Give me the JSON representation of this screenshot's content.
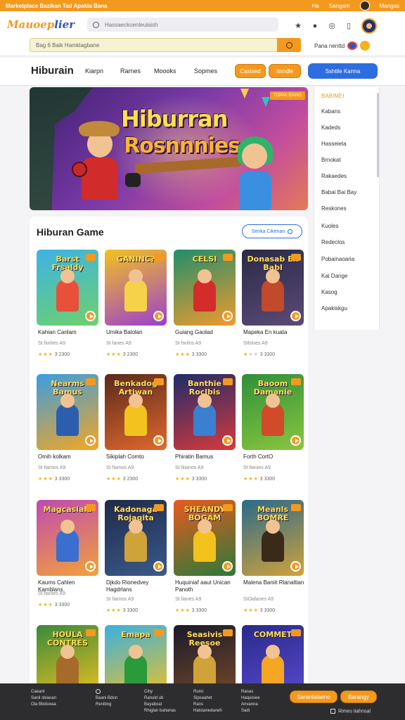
{
  "topbar": {
    "left_text": "Marketplace  Bazikan  Tad  Apakia  Bana",
    "links": [
      "Ha",
      "Sangam"
    ],
    "user_label": "Mangas"
  },
  "header": {
    "logo_main": "Mauoep",
    "logo_accent": "lier",
    "search_placeholder": "Hassaeckoenleulaish"
  },
  "search2": {
    "value": "Bag 6 Baik  Hamklagbane",
    "right_label": "Pana nenttd"
  },
  "nav": {
    "title": "Hiburain",
    "links": [
      "Kiarpn",
      "Rarnes",
      "Moooks",
      "Sopmes"
    ],
    "pill1": "Castsed",
    "pill2": "Itnndle",
    "cta": "Sshtile Karma"
  },
  "banner": {
    "title_line1": "Hiburran",
    "title_line2": "Rosnnnies",
    "badge": "TOPAK BIANG"
  },
  "sidebar": {
    "items": [
      "BABIMEI",
      "Kabans",
      "Kadeds",
      "Hasseieta",
      "Brnokat",
      "Rakaedes",
      "Babai Bai Bay",
      "Reskones",
      "Kuoles",
      "Redeclos",
      "Pobainaoaria",
      "Kai Dange",
      "Kasog",
      "Apakiskgu"
    ]
  },
  "games": {
    "title": "Hiburan Game",
    "see_all": "Senka Cikenan",
    "items": [
      {
        "thumb_title": "Barst Frsaldy",
        "name": "Kahian Canlam",
        "meta": "St fiinhes A9",
        "stars": 3,
        "count": "3 2300"
      },
      {
        "thumb_title": "GANINC?",
        "name": "Umika Balolan",
        "meta": "St fanes A9",
        "stars": 3,
        "count": "3 2300"
      },
      {
        "thumb_title": "CELSI",
        "name": "Guiang Gaolad",
        "meta": "St fsnlns A9",
        "stars": 3,
        "count": "3 3300"
      },
      {
        "thumb_title": "Donasab En Babl",
        "name": "Mapeka En kuata",
        "meta": "Stlsloes A9",
        "stars": 1,
        "count": "3 3300"
      },
      {
        "thumb_title": "Nearms Bamus",
        "name": "Omih kolkam",
        "meta": "St fiamos A9",
        "stars": 3,
        "count": "3 3300"
      },
      {
        "thumb_title": "Benkadog Artiwan",
        "name": "Sikiplah Comto",
        "meta": "St fiamos A9",
        "stars": 3,
        "count": "3 2300"
      },
      {
        "thumb_title": "Banthie Roclbis",
        "name": "Phiratin Bamus",
        "meta": "St fiiianos A9",
        "stars": 3,
        "count": "3 3300"
      },
      {
        "thumb_title": "Baoom Damanie",
        "name": "Forth CortO",
        "meta": "St fianies A9",
        "stars": 3,
        "count": "3 3300"
      },
      {
        "thumb_title": "Magcasiala",
        "name": "Kaums Cahlen Kamblans",
        "meta": "St fianies A9",
        "stars": 3,
        "count": "3 3300"
      },
      {
        "thumb_title": "Kadonaga Rojaqita",
        "name": "Djkdo Rionedvey Hagdrlans",
        "meta": "St fiamos A9",
        "stars": 3,
        "count": "3 3300"
      },
      {
        "thumb_title": "SHEANDY BOGAM",
        "name": "Huquiniaf aaut Unican Panoth",
        "meta": "St fianes A9",
        "stars": 3,
        "count": "3 3300"
      },
      {
        "thumb_title": "Meanls BOMRE",
        "name": "Malena Baniit Rlanaltian",
        "meta": "StOafanes A9",
        "stars": 3,
        "count": "3 3300"
      },
      {
        "thumb_title": "HOULA CONTRES",
        "name": "",
        "meta": "",
        "stars": 0,
        "count": ""
      },
      {
        "thumb_title": "Emapa",
        "name": "",
        "meta": "",
        "stars": 0,
        "count": ""
      },
      {
        "thumb_title": "Seasivis Reesoe",
        "name": "",
        "meta": "",
        "stars": 0,
        "count": ""
      },
      {
        "thumb_title": "COMMET",
        "name": "",
        "meta": "",
        "stars": 0,
        "count": ""
      }
    ]
  },
  "footer": {
    "col1": [
      "Caeant",
      "Sanil sbiaoan",
      "Ola Bbdswaa"
    ],
    "col2": [
      "Bang",
      "Baani Bdon",
      "Renibng"
    ],
    "col3": [
      "Cihy",
      "Ranuld ub",
      "Bayaboal",
      "Rhiglan bahanas"
    ],
    "col4": [
      "Rumi",
      "Sipsaahet",
      "Rans",
      "Hatstanedaneh"
    ],
    "col5": [
      "Ranas",
      "Haquisiee",
      "Anvanna",
      "Sadi"
    ],
    "btn1": "Sarantalaeno",
    "btn2": "Barangy",
    "check_label": "Rimes Iiahnsal"
  }
}
